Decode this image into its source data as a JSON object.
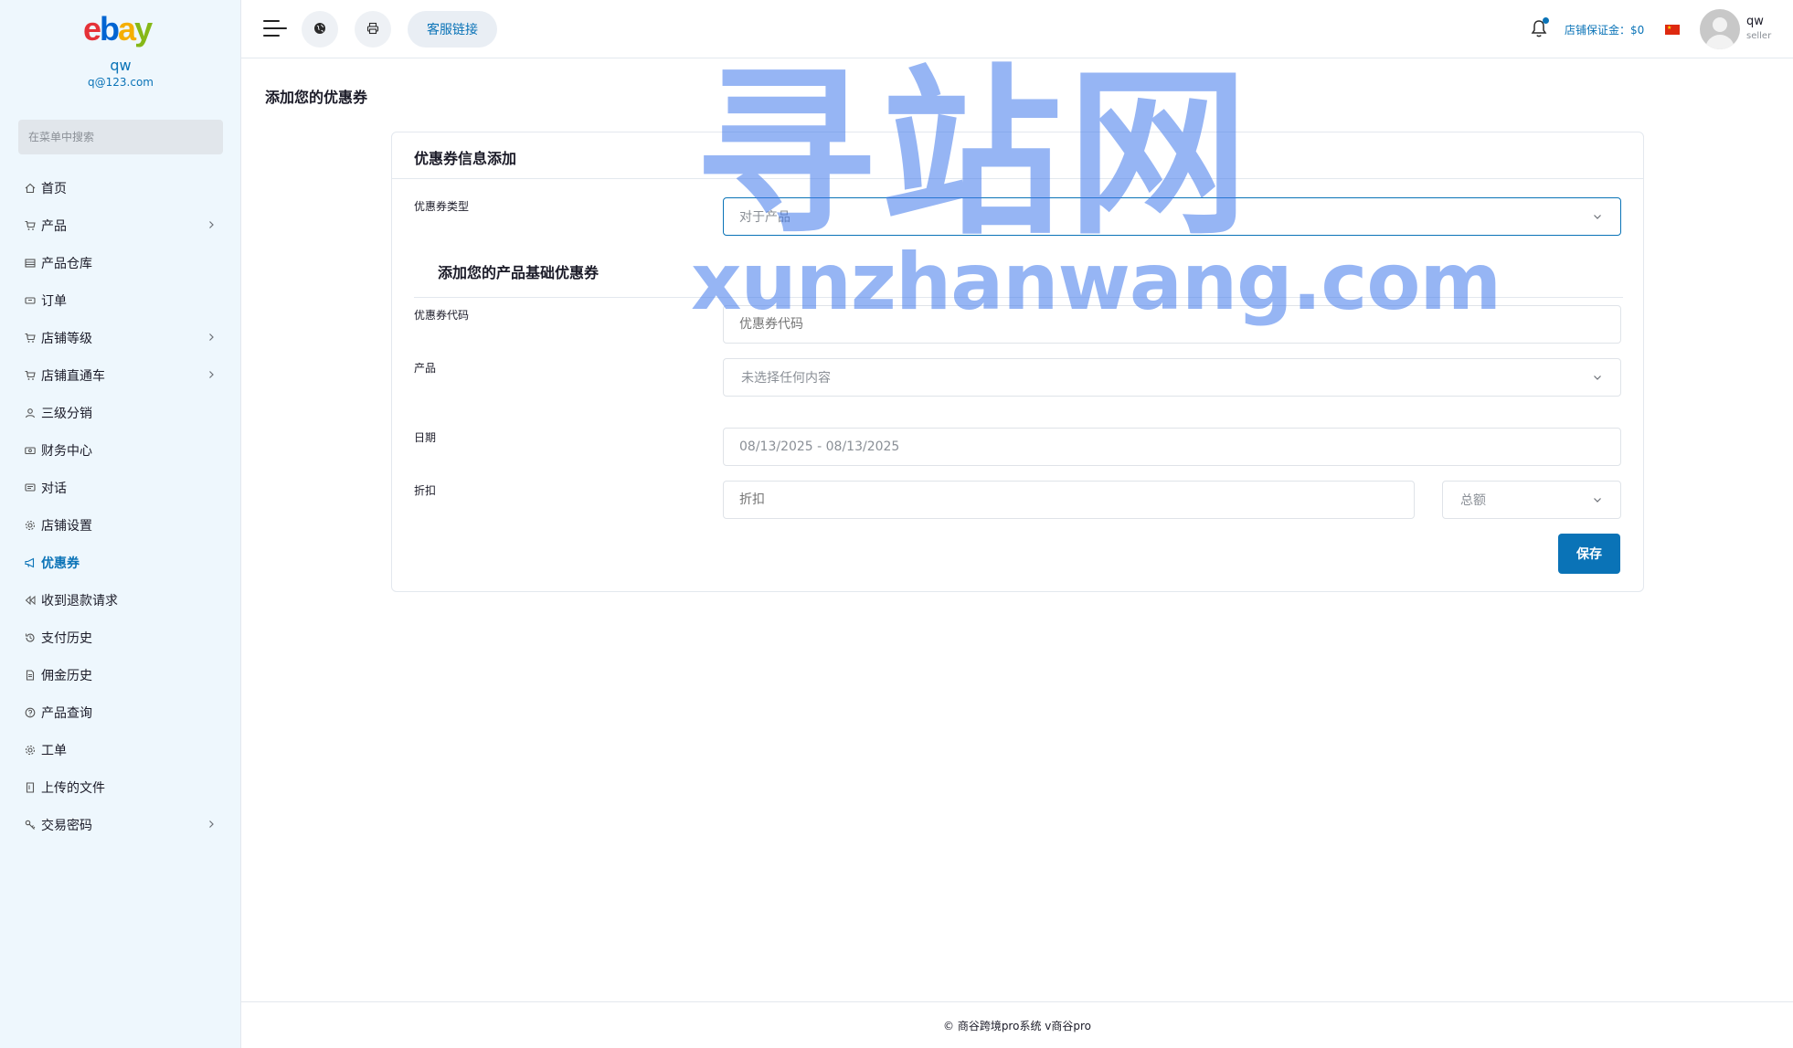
{
  "sidebar": {
    "logo": "ebay",
    "user_name": "qw",
    "user_email": "q@123.com",
    "search_placeholder": "在菜单中搜索",
    "items": [
      {
        "label": "首页",
        "icon": "home-icon",
        "has_children": false
      },
      {
        "label": "产品",
        "icon": "cart-icon",
        "has_children": true
      },
      {
        "label": "产品仓库",
        "icon": "warehouse-icon",
        "has_children": false
      },
      {
        "label": "订单",
        "icon": "ticket-icon",
        "has_children": false
      },
      {
        "label": "店铺等级",
        "icon": "cart-icon",
        "has_children": true
      },
      {
        "label": "店铺直通车",
        "icon": "cart-icon",
        "has_children": true
      },
      {
        "label": "三级分销",
        "icon": "user-icon",
        "has_children": false
      },
      {
        "label": "财务中心",
        "icon": "money-icon",
        "has_children": false
      },
      {
        "label": "对话",
        "icon": "chat-icon",
        "has_children": false
      },
      {
        "label": "店铺设置",
        "icon": "gear-icon",
        "has_children": false
      },
      {
        "label": "优惠券",
        "icon": "megaphone-icon",
        "has_children": false,
        "active": true
      },
      {
        "label": "收到退款请求",
        "icon": "rewind-icon",
        "has_children": false
      },
      {
        "label": "支付历史",
        "icon": "history-icon",
        "has_children": false
      },
      {
        "label": "佣金历史",
        "icon": "file-icon",
        "has_children": false
      },
      {
        "label": "产品查询",
        "icon": "question-icon",
        "has_children": false
      },
      {
        "label": "工单",
        "icon": "gear-icon",
        "has_children": false
      },
      {
        "label": "上传的文件",
        "icon": "folder-icon",
        "has_children": false
      },
      {
        "label": "交易密码",
        "icon": "key-icon",
        "has_children": true
      }
    ]
  },
  "topbar": {
    "service_link": "客服链接",
    "deposit": "店铺保证金：$0",
    "user_name": "qw",
    "user_role": "seller"
  },
  "page": {
    "title": "添加您的优惠券"
  },
  "card": {
    "header": "优惠券信息添加",
    "coupon_type_label": "优惠券类型",
    "coupon_type_value": "对于产品",
    "subsection_title": "添加您的产品基础优惠券",
    "coupon_code_label": "优惠券代码",
    "coupon_code_placeholder": "优惠券代码",
    "product_label": "产品",
    "product_value": "未选择任何内容",
    "date_label": "日期",
    "date_value": "08/13/2025 - 08/13/2025",
    "discount_label": "折扣",
    "discount_placeholder": "折扣",
    "discount_type_value": "总额",
    "save_label": "保存"
  },
  "footer": {
    "text": "© 商谷跨境pro系统 v商谷pro"
  },
  "watermark": {
    "cn": "寻站网",
    "en": "xunzhanwang.com"
  },
  "colors": {
    "accent": "#0a73b7",
    "sidebar_bg": "#eef7fd",
    "watermark": "#3f78eb"
  }
}
